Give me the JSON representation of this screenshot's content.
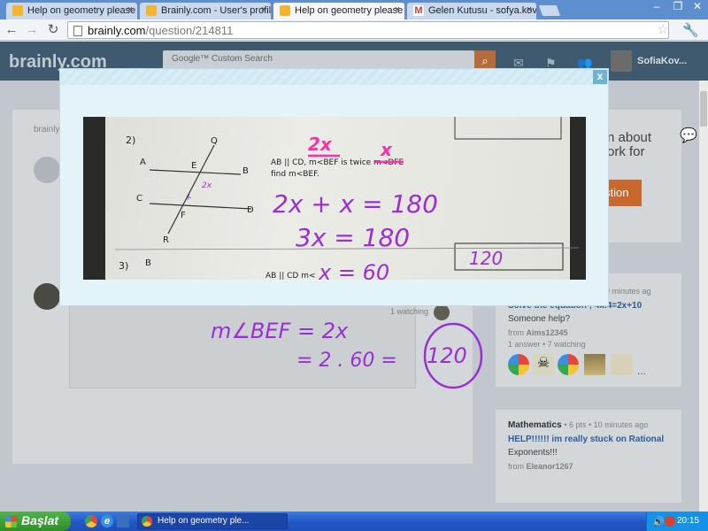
{
  "browser": {
    "tabs": [
      {
        "label": "Help on geometry please wit",
        "favicon": "brainly-icon"
      },
      {
        "label": "Brainly.com - User's profile",
        "favicon": "brainly-icon"
      },
      {
        "label": "Help on geometry please sho",
        "favicon": "brainly-icon",
        "active": true
      },
      {
        "label": "Gelen Kutusu - sofya.kovale",
        "favicon": "gmail-icon"
      }
    ],
    "url_host": "brainly.com",
    "url_path": "/question/214811",
    "close_glyph": "×"
  },
  "site": {
    "logo": "brainly.com",
    "search_placeholder": "Google™ Custom Search",
    "username": "SofiaKov...",
    "breadcrumb": "brainly",
    "promo_text_1": "n about",
    "promo_text_2": "ork for",
    "promo_button": "stion",
    "sidebar_questions": [
      {
        "meta": "9 minutes ag",
        "title": "Solve the equation ; 4x.4=2x+10",
        "body": "Someone help?",
        "from": "from",
        "author": "Aims12345",
        "stats": "1 answer • 7 watching"
      },
      {
        "subject": "Mathematics",
        "meta": "• 6 pts • 10 minutes ago",
        "title": "HELP!!!!!! im really stuck on Rational",
        "body": "Exponents!!!",
        "from": "from",
        "author": "Eleanor1267"
      }
    ],
    "watching": "1 watching",
    "more_dots": "..."
  },
  "modal": {
    "close_label": "x",
    "photo": {
      "problem_number": "2)",
      "problem_text_1": "AB || CD, m<BEF is twice m<DFE",
      "problem_text_2": "find m<BEF.",
      "problem_number_next": "3)",
      "problem_next_text": "AB || CD m<",
      "labels": {
        "Q": "Q",
        "A": "A",
        "E": "E",
        "B": "B",
        "C": "C",
        "F": "F",
        "D": "D",
        "R": "R",
        "B2": "B",
        "A2": "A"
      },
      "hand_top_2x": "2x",
      "hand_top_x": "x",
      "hand_angle_2x": "2x",
      "hand_angle_x": "x",
      "eq1": "2x + x = 180",
      "eq2": "3x = 180",
      "eq3": "x = 60",
      "boxed_answer": "120"
    }
  },
  "answer": {
    "line1": "m∠BEF = 2x",
    "line2": "= 2 . 60 =",
    "circled": "120"
  },
  "taskbar": {
    "start_label": "Başlat",
    "task_label": "Help on geometry ple...",
    "clock": "20:15"
  },
  "colors": {
    "handwriting_purple": "#9b2fd6",
    "handwriting_pink": "#ff2ea8",
    "brainly_orange": "#e56d25"
  }
}
